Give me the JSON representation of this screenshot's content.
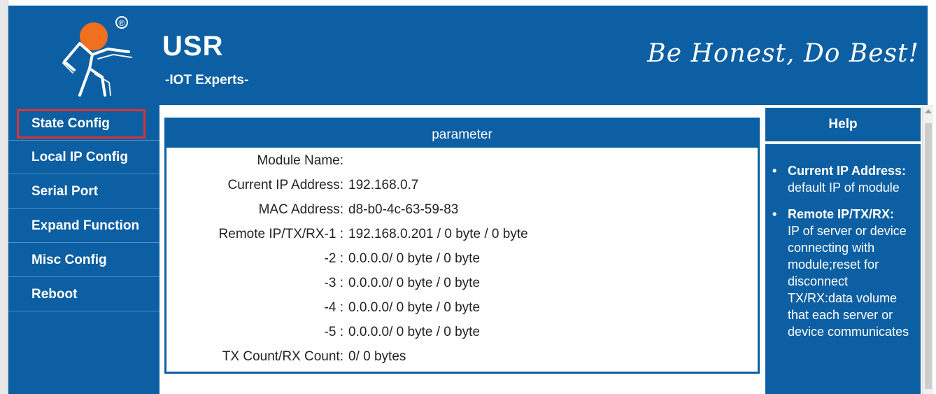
{
  "header": {
    "brand": "USR",
    "subbrand": "-IOT Experts-",
    "slogan": "Be Honest, Do Best!",
    "registered_mark": "®"
  },
  "sidebar": {
    "items": [
      {
        "label": "State Config",
        "selected": true
      },
      {
        "label": "Local IP Config"
      },
      {
        "label": "Serial Port"
      },
      {
        "label": "Expand Function"
      },
      {
        "label": "Misc Config"
      },
      {
        "label": "Reboot"
      }
    ]
  },
  "parameter": {
    "title": "parameter",
    "rows": [
      {
        "label": "Module Name:",
        "value": ""
      },
      {
        "label": "Current IP Address:",
        "value": "192.168.0.7"
      },
      {
        "label": "MAC Address:",
        "value": "d8-b0-4c-63-59-83"
      },
      {
        "label": "Remote IP/TX/RX-1 :",
        "value": "192.168.0.201 / 0 byte / 0 byte"
      },
      {
        "label": "-2 :",
        "value": "0.0.0.0/ 0 byte / 0 byte"
      },
      {
        "label": "-3 :",
        "value": "0.0.0.0/ 0 byte / 0 byte"
      },
      {
        "label": "-4 :",
        "value": "0.0.0.0/ 0 byte / 0 byte"
      },
      {
        "label": "-5 :",
        "value": "0.0.0.0/ 0 byte / 0 byte"
      },
      {
        "label": "TX Count/RX Count:",
        "value": "0/ 0 bytes"
      }
    ]
  },
  "help": {
    "title": "Help",
    "items": [
      {
        "bullet": "•",
        "term": "Current IP Address:",
        "desc": "default IP of module"
      },
      {
        "bullet": "•",
        "term": "Remote IP/TX/RX:",
        "desc": "IP of server or device connecting with module;reset for disconnect TX/RX:data volume that each server or device communicates"
      }
    ]
  },
  "colors": {
    "brand_blue": "#0d5fa3",
    "logo_orange": "#f07020",
    "selection_red": "#e03030"
  },
  "icons": {
    "logo": "usr-running-figure-logo",
    "scroll_up": "scroll-up-arrow"
  }
}
